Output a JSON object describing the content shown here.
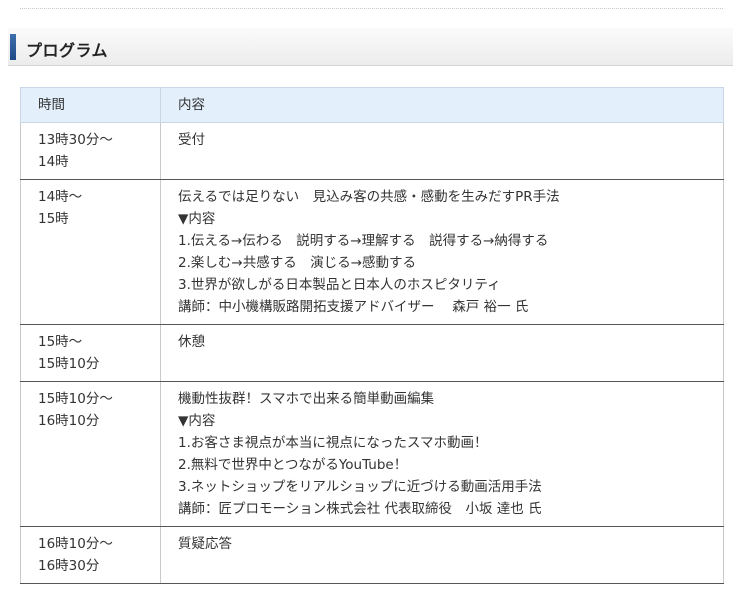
{
  "section": {
    "title": "プログラム"
  },
  "table": {
    "headers": [
      "時間",
      "内容"
    ],
    "rows": [
      {
        "time": [
          "13時30分～",
          "14時"
        ],
        "content": [
          "受付"
        ]
      },
      {
        "time": [
          "14時～",
          "15時"
        ],
        "content": [
          "伝えるでは足りない　見込み客の共感・感動を生みだすPR手法",
          "▼内容",
          "1.伝える→伝わる　説明する→理解する　説得する→納得する",
          "2.楽しむ→共感する　演じる→感動する",
          "3.世界が欲しがる日本製品と日本人のホスピタリティ",
          "講師：中小機構販路開拓支援アドバイザー　 森戸 裕一 氏"
        ]
      },
      {
        "time": [
          "15時～",
          "15時10分"
        ],
        "content": [
          "休憩"
        ]
      },
      {
        "time": [
          "15時10分～",
          "16時10分"
        ],
        "content": [
          "機動性抜群！スマホで出来る簡単動画編集",
          "▼内容",
          "1.お客さま視点が本当に視点になったスマホ動画！",
          "2.無料で世界中とつながるYouTube！",
          "3.ネットショップをリアルショップに近づける動画活用手法",
          "講師：匠プロモーション株式会社 代表取締役　小坂 達也 氏"
        ]
      },
      {
        "time": [
          "16時10分～",
          "16時30分"
        ],
        "content": [
          "質疑応答"
        ]
      }
    ]
  }
}
